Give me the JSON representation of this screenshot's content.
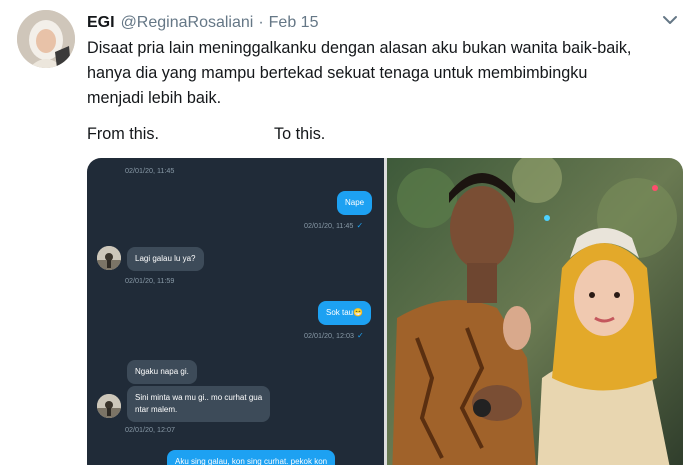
{
  "tweet": {
    "display_name": "EGI",
    "handle": "@ReginaRosaliani",
    "separator": "·",
    "date": "Feb 15",
    "text_lines": [
      "Disaat pria lain meninggalkanku dengan alasan aku bukan wanita baik-baik,",
      "hanya dia yang mampu bertekad sekuat tenaga untuk membimbingku",
      "menjadi lebih baik."
    ],
    "caption_left": "From this.",
    "caption_right": "To this."
  },
  "chat": {
    "messages": [
      {
        "timestamp": "02/01/20, 11:45"
      },
      {
        "text": "Nape",
        "timestamp": "02/01/20, 11:45"
      },
      {
        "text": "Lagi galau lu ya?",
        "timestamp": "02/01/20, 11:59"
      },
      {
        "text": "Sok tau😁",
        "timestamp": "02/01/20, 12:03"
      },
      {
        "text": "Ngaku napa gi.",
        "text2": "Sini minta wa mu gi.. mo curhat gua",
        "text3": "ntar malem.",
        "timestamp": "02/01/20, 12:07"
      },
      {
        "text": "Aku sing galau, kon sing curhat. pekok kon"
      }
    ]
  },
  "icons": {
    "chevron": "chevron-down-icon",
    "check": "check-icon"
  },
  "colors": {
    "chat_bg": "#202b38",
    "bubble_out": "#1da1f2",
    "bubble_in": "#3d4b59",
    "muted": "#657786"
  }
}
